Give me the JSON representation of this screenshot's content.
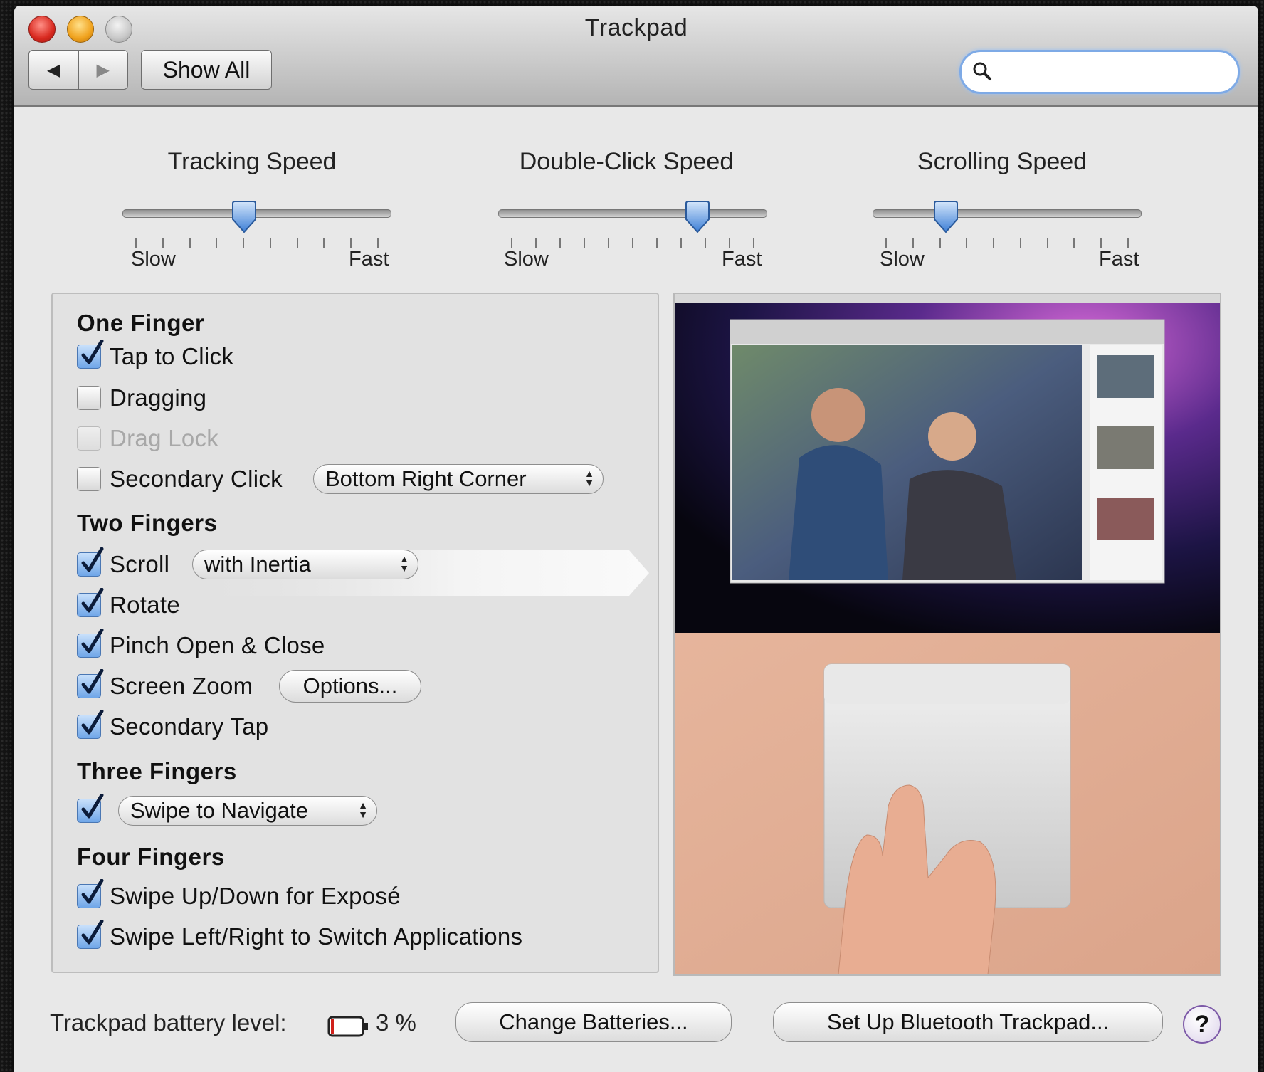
{
  "window": {
    "title": "Trackpad"
  },
  "toolbar": {
    "back_label": "◀",
    "forward_label": "▶",
    "show_all_label": "Show All",
    "search_placeholder": ""
  },
  "sliders": [
    {
      "label": "Tracking Speed",
      "min_label": "Slow",
      "max_label": "Fast",
      "ticks": 10,
      "value_fraction": 0.45
    },
    {
      "label": "Double-Click Speed",
      "min_label": "Slow",
      "max_label": "Fast",
      "ticks": 11,
      "value_fraction": 0.77
    },
    {
      "label": "Scrolling Speed",
      "min_label": "Slow",
      "max_label": "Fast",
      "ticks": 10,
      "value_fraction": 0.25
    }
  ],
  "sections": {
    "one_finger": {
      "title": "One Finger",
      "tap_to_click": {
        "label": "Tap to Click",
        "checked": true
      },
      "dragging": {
        "label": "Dragging",
        "checked": false
      },
      "drag_lock": {
        "label": "Drag Lock",
        "checked": false,
        "disabled": true
      },
      "secondary_click": {
        "label": "Secondary Click",
        "checked": false,
        "popup": "Bottom Right Corner"
      }
    },
    "two_fingers": {
      "title": "Two Fingers",
      "scroll": {
        "label": "Scroll",
        "checked": true,
        "popup": "with Inertia"
      },
      "rotate": {
        "label": "Rotate",
        "checked": true
      },
      "pinch": {
        "label": "Pinch Open & Close",
        "checked": true
      },
      "screen_zoom": {
        "label": "Screen Zoom",
        "checked": true,
        "button": "Options..."
      },
      "secondary_tap": {
        "label": "Secondary Tap",
        "checked": true
      }
    },
    "three_fingers": {
      "title": "Three Fingers",
      "swipe": {
        "checked": true,
        "popup": "Swipe to Navigate"
      }
    },
    "four_fingers": {
      "title": "Four Fingers",
      "expose": {
        "label": "Swipe Up/Down for Exposé",
        "checked": true
      },
      "switch_apps": {
        "label": "Swipe Left/Right to Switch Applications",
        "checked": true
      }
    }
  },
  "footer": {
    "battery_label": "Trackpad battery level:",
    "battery_value": "3 %",
    "change_batteries": "Change Batteries...",
    "setup_bluetooth": "Set Up Bluetooth Trackpad...",
    "help": "?"
  },
  "colors": {
    "accent": "#5e96de",
    "search_ring": "#7eaae6",
    "help_ring": "#7d5aa8"
  }
}
